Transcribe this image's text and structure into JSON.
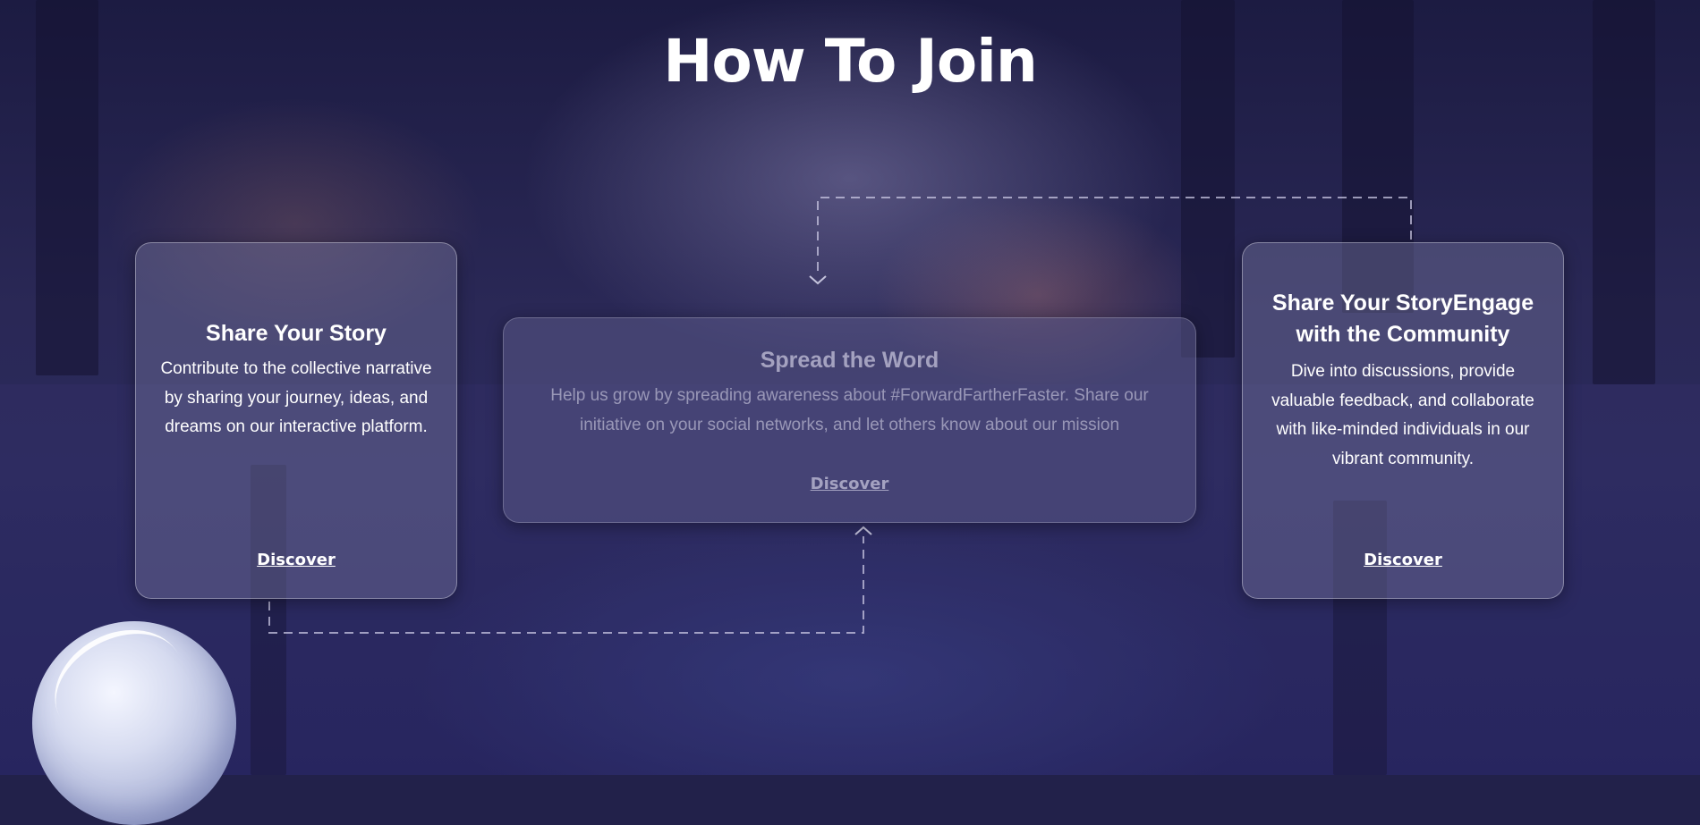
{
  "title": "How To Join",
  "cards": [
    {
      "title": "Share Your Story",
      "body": "Contribute to the collective narrative by sharing your journey, ideas, and dreams on our interactive platform.",
      "link": "Discover"
    },
    {
      "title": "Spread the Word",
      "body": "Help us grow by spreading awareness about #ForwardFartherFaster. Share our initiative on your social networks, and let others know about our mission",
      "link": "Discover"
    },
    {
      "title": "Share Your StoryEngage with the Community",
      "body": "Dive into discussions, provide valuable feedback, and collaborate with like-minded individuals in our vibrant community.",
      "link": "Discover"
    }
  ],
  "colors": {
    "background": "#22214a",
    "text": "#ffffff"
  },
  "icons": [
    "chevron-down-icon",
    "chevron-up-icon",
    "decorative-orb"
  ]
}
